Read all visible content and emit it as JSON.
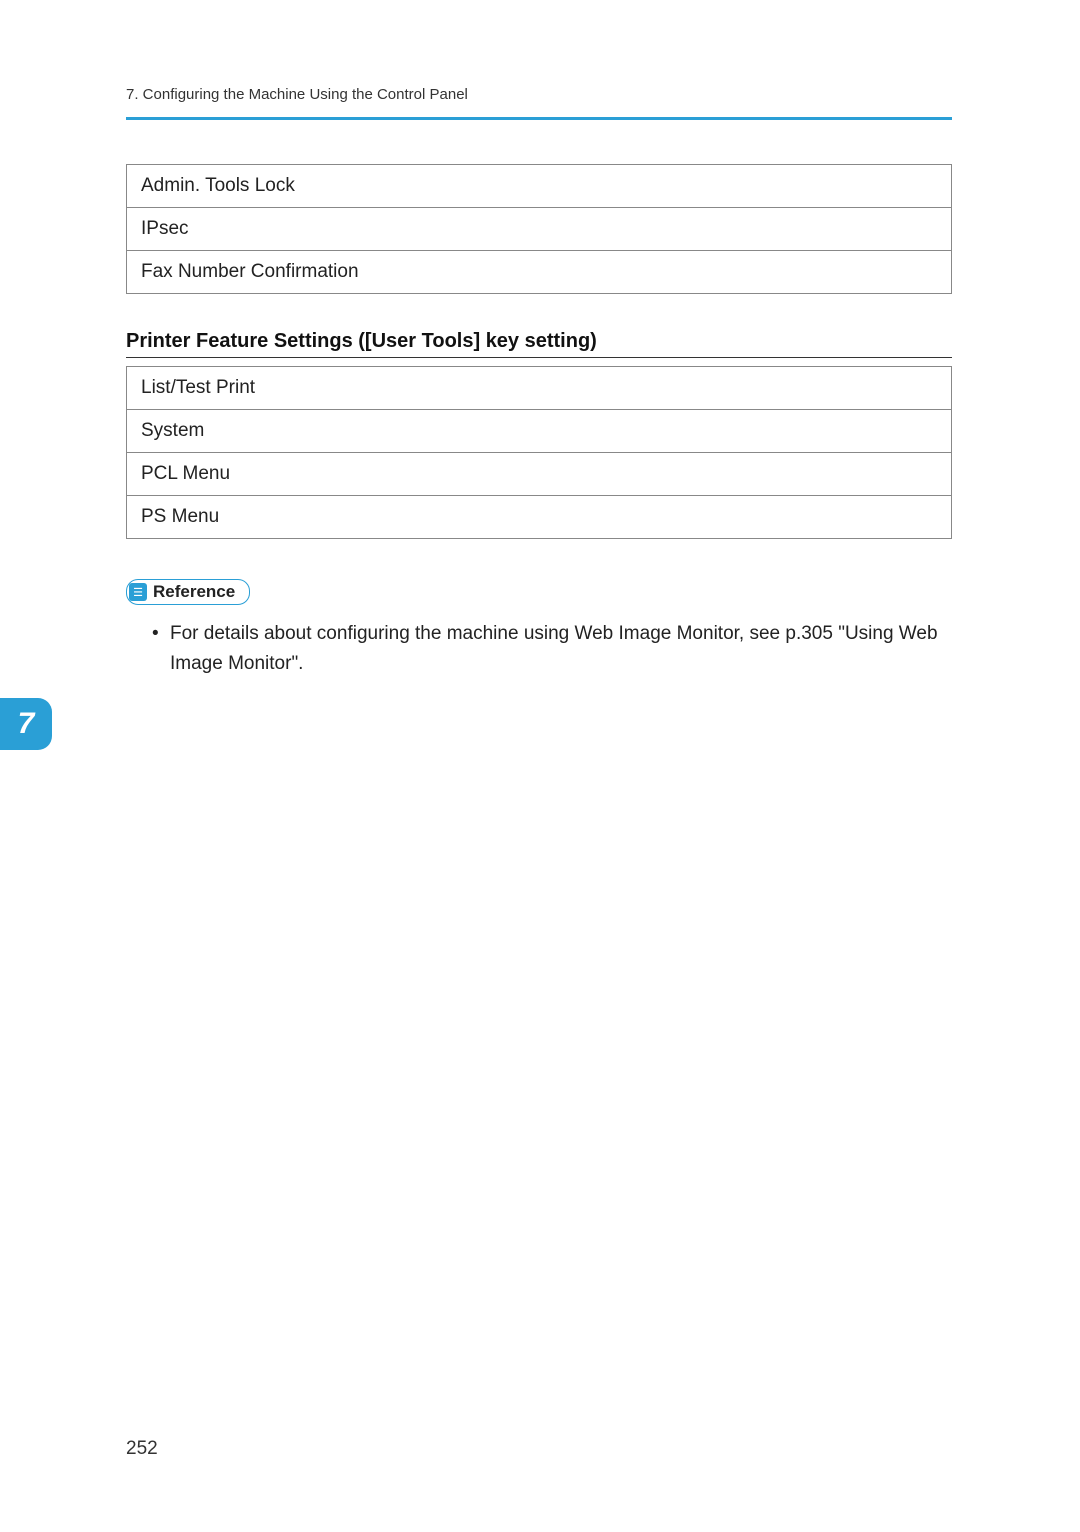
{
  "header": {
    "chapter_title": "7. Configuring the Machine Using the Control Panel"
  },
  "table1": {
    "rows": [
      "Admin. Tools Lock",
      "IPsec",
      "Fax Number Confirmation"
    ]
  },
  "section2": {
    "heading": "Printer Feature Settings ([User Tools] key setting)"
  },
  "table2": {
    "rows": [
      "List/Test Print",
      "System",
      "PCL Menu",
      "PS Menu"
    ]
  },
  "reference": {
    "label": "Reference",
    "items": [
      "For details about configuring the machine using Web Image Monitor, see p.305 \"Using Web Image Monitor\"."
    ]
  },
  "chapter_tab": "7",
  "page_number": "252"
}
